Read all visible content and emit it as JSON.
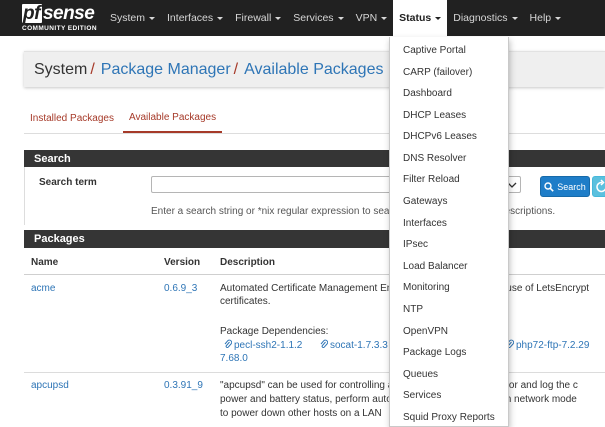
{
  "brand": {
    "logo_prefix": "pf",
    "logo_suffix": "sense",
    "edition": "COMMUNITY EDITION"
  },
  "nav": {
    "items": [
      {
        "label": "System"
      },
      {
        "label": "Interfaces"
      },
      {
        "label": "Firewall"
      },
      {
        "label": "Services"
      },
      {
        "label": "VPN"
      },
      {
        "label": "Status"
      },
      {
        "label": "Diagnostics"
      },
      {
        "label": "Help"
      }
    ],
    "active": "Status"
  },
  "breadcrumb": {
    "root": "System",
    "section": "Package Manager",
    "page": "Available Packages",
    "separator": "/"
  },
  "tabs": [
    {
      "label": "Installed Packages"
    },
    {
      "label": "Available Packages"
    }
  ],
  "tabs_active": "Available Packages",
  "search": {
    "title": "Search",
    "term_label": "Search term",
    "input_value": "",
    "button_label": "Search",
    "help_text": "Enter a search string or *nix regular expression to search package names and descriptions."
  },
  "packages": {
    "title": "Packages",
    "headers": {
      "name": "Name",
      "version": "Version",
      "description": "Description"
    },
    "rows": [
      {
        "name": "acme",
        "version": "0.6.9_3",
        "description_lines": [
          "Automated Certificate Management Environment, for automated use of LetsEncrypt",
          "certificates."
        ],
        "deps_label": "Package Dependencies:",
        "deps": [
          "pecl-ssh2-1.1.2",
          "socat-1.7.3.3",
          "php72-ftp-7.2.29",
          "7.68.0"
        ]
      },
      {
        "name": "apcupsd",
        "version": "0.3.91_9",
        "description_lines": [
          "\"apcupsd\" can be used for controlling all APC UPS models, monitor and log the c",
          "power and battery status, perform automatic shutdown, and run in network mode",
          "to power down other hosts on a LAN"
        ]
      }
    ]
  },
  "status_menu": {
    "items": [
      "Captive Portal",
      "CARP (failover)",
      "Dashboard",
      "DHCP Leases",
      "DHCPv6 Leases",
      "DNS Resolver",
      "Filter Reload",
      "Gateways",
      "Interfaces",
      "IPsec",
      "Load Balancer",
      "Monitoring",
      "NTP",
      "OpenVPN",
      "Package Logs",
      "Queues",
      "Services",
      "Squid Proxy Reports"
    ]
  },
  "colors": {
    "navbar": "#212121",
    "accent_red": "#a63a29",
    "link_blue": "#2e75b6",
    "panel_header": "#353535",
    "button_primary": "#1e7dc8",
    "button_info": "#5bc0de"
  },
  "icons": {
    "search_button": "search-icon",
    "clear_button": "undo-icon",
    "dependency": "paperclip-icon",
    "menu_toggle": "caret-down-icon"
  }
}
